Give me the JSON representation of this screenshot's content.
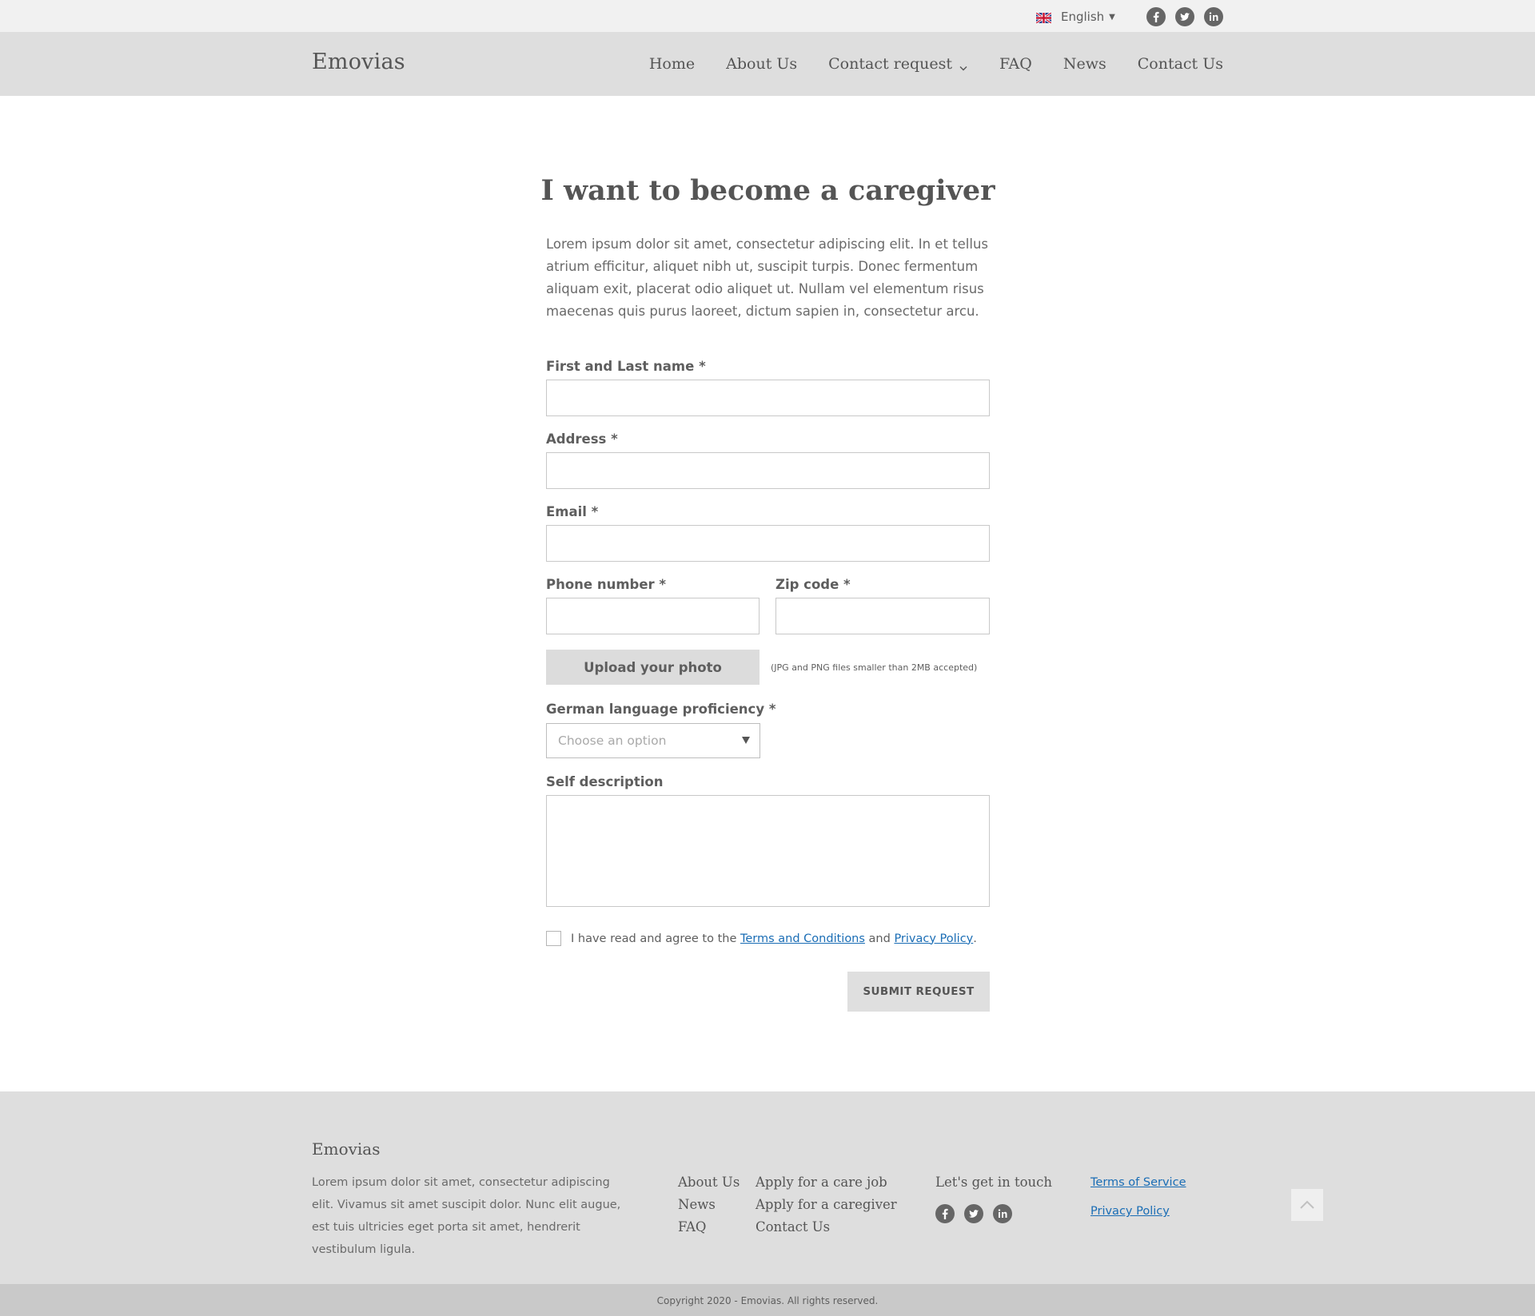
{
  "topbar": {
    "language": "English",
    "social": [
      "facebook-icon",
      "twitter-icon",
      "linkedin-icon"
    ]
  },
  "header": {
    "logo": "Emovias",
    "nav": [
      {
        "label": "Home"
      },
      {
        "label": "About Us"
      },
      {
        "label": "Contact request"
      },
      {
        "label": "FAQ"
      },
      {
        "label": "News"
      },
      {
        "label": "Contact Us"
      }
    ]
  },
  "main": {
    "title": "I want to become a caregiver",
    "intro": "Lorem ipsum dolor sit amet, consectetur adipiscing elit. In et tellus atrium efficitur, aliquet nibh ut, suscipit turpis. Donec fermentum aliquam exit, placerat odio aliquet ut. Nullam vel elementum risus maecenas quis purus laoreet, dictum sapien in, consectetur arcu."
  },
  "form": {
    "name_label": "First and Last name *",
    "name_value": "",
    "address_label": "Address *",
    "address_value": "",
    "email_label": "Email *",
    "email_value": "",
    "phone_label": "Phone number *",
    "phone_value": "",
    "zip_label": "Zip code *",
    "zip_value": "",
    "upload_label": "Upload your photo",
    "upload_hint": "(JPG and PNG files smaller than 2MB accepted)",
    "german_label": "German language proficiency *",
    "german_placeholder": "Choose an option",
    "self_label": "Self description",
    "self_value": "",
    "agree_prefix": "I have read and agree to the",
    "agree_terms": "Terms and Conditions",
    "agree_and": "and",
    "agree_privacy": "Privacy Policy",
    "agree_suffix": ".",
    "submit_label": "SUBMIT REQUEST"
  },
  "footer": {
    "logo": "Emovias",
    "text": "Lorem ipsum dolor sit amet, consectetur adipiscing elit. Vivamus sit amet suscipit dolor. Nunc elit augue, est tuis ultricies eget porta sit amet, hendrerit vestibulum ligula.",
    "col1": [
      "About Us",
      "News",
      "FAQ"
    ],
    "col2": [
      "Apply for a care job",
      "Apply for a caregiver",
      "Contact Us"
    ],
    "touch": "Let's get in touch",
    "legal": [
      "Terms of Service",
      "Privacy Policy"
    ],
    "copyright": "Copyright 2020 -  Emovias. All rights reserved."
  },
  "colors": {
    "topbar_bg": "#f1f1f1",
    "header_bg": "#dedede",
    "footer_bg": "#dedede",
    "copyright_bg": "#c9c9c9",
    "link": "#1a6db5",
    "button_bg": "#dcdcdc"
  }
}
